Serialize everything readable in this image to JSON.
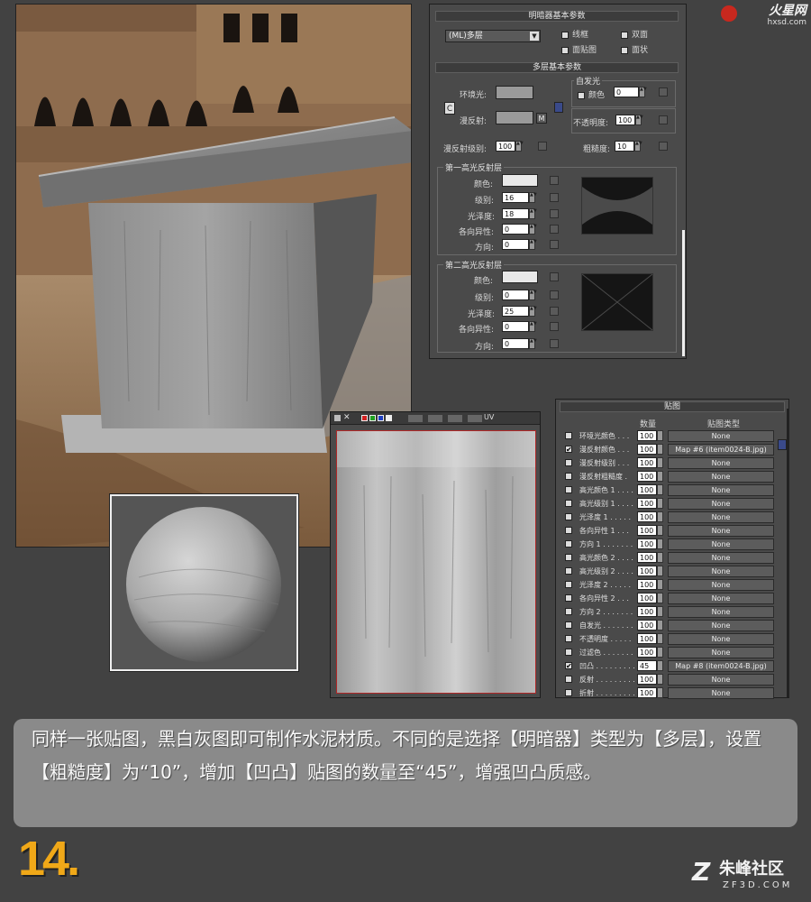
{
  "watermark_top": {
    "brand": "火星网",
    "domain": "hxsd.com"
  },
  "shader_panel": {
    "title": "明暗器基本参数",
    "shader_type": "(ML)多层",
    "checkboxes": [
      "线框",
      "双面",
      "面贴图",
      "面状"
    ],
    "multilayer_title": "多层基本参数",
    "ambient_label": "环境光:",
    "diffuse_label": "漫反射:",
    "lock_glyph": "C",
    "m_button": "M",
    "self_illum_group": "自发光",
    "color_label": "颜色",
    "self_illum_value": "0",
    "opacity_label": "不透明度:",
    "opacity_value": "100",
    "diffuse_level_label": "漫反射级别:",
    "diffuse_level_value": "100",
    "roughness_label": "粗糙度:",
    "roughness_value": "10",
    "spec1": {
      "title": "第一高光反射层",
      "color_label": "颜色:",
      "level_label": "级别:",
      "level": "16",
      "gloss_label": "光泽度:",
      "gloss": "18",
      "aniso_label": "各向异性:",
      "aniso": "0",
      "orient_label": "方向:",
      "orient": "0"
    },
    "spec2": {
      "title": "第二高光反射层",
      "color_label": "颜色:",
      "level_label": "级别:",
      "level": "0",
      "gloss_label": "光泽度:",
      "gloss": "25",
      "aniso_label": "各向异性:",
      "aniso": "0",
      "orient_label": "方向:",
      "orient": "0"
    }
  },
  "maps_panel": {
    "title": "贴图",
    "col_amount": "数量",
    "col_type": "贴图类型",
    "rows": [
      {
        "name": "环境光颜色 . . .",
        "checked": false,
        "amount": "100",
        "map": "None"
      },
      {
        "name": "漫反射颜色 . . .",
        "checked": true,
        "amount": "100",
        "map": "Map #6 (item0024-B.jpg)"
      },
      {
        "name": "漫反射级别 . . .",
        "checked": false,
        "amount": "100",
        "map": "None"
      },
      {
        "name": "漫反射粗糙度 .",
        "checked": false,
        "amount": "100",
        "map": "None"
      },
      {
        "name": "高光颜色 1 . . . .",
        "checked": false,
        "amount": "100",
        "map": "None"
      },
      {
        "name": "高光级别 1 . . . .",
        "checked": false,
        "amount": "100",
        "map": "None"
      },
      {
        "name": "光泽度 1 . . . . .",
        "checked": false,
        "amount": "100",
        "map": "None"
      },
      {
        "name": "各向异性 1 . . .",
        "checked": false,
        "amount": "100",
        "map": "None"
      },
      {
        "name": "方向 1 . . . . . . .",
        "checked": false,
        "amount": "100",
        "map": "None"
      },
      {
        "name": "高光颜色 2 . . . .",
        "checked": false,
        "amount": "100",
        "map": "None"
      },
      {
        "name": "高光级别 2 . . . .",
        "checked": false,
        "amount": "100",
        "map": "None"
      },
      {
        "name": "光泽度 2 . . . . .",
        "checked": false,
        "amount": "100",
        "map": "None"
      },
      {
        "name": "各向异性 2 . . .",
        "checked": false,
        "amount": "100",
        "map": "None"
      },
      {
        "name": "方向 2 . . . . . . .",
        "checked": false,
        "amount": "100",
        "map": "None"
      },
      {
        "name": "自发光 . . . . . . .",
        "checked": false,
        "amount": "100",
        "map": "None"
      },
      {
        "name": "不透明度 . . . . .",
        "checked": false,
        "amount": "100",
        "map": "None"
      },
      {
        "name": "过滤色 . . . . . . .",
        "checked": false,
        "amount": "100",
        "map": "None"
      },
      {
        "name": "凹凸 . . . . . . . . .",
        "checked": true,
        "amount": "45",
        "map": "Map #8 (item0024-B.jpg)"
      },
      {
        "name": "反射 . . . . . . . . .",
        "checked": false,
        "amount": "100",
        "map": "None"
      },
      {
        "name": "折射 . . . . . . . . .",
        "checked": false,
        "amount": "100",
        "map": "None"
      }
    ]
  },
  "texture_window": {
    "uv_label": "UV"
  },
  "caption": {
    "text": "同样一张贴图，黑白灰图即可制作水泥材质。不同的是选择【明暗器】类型为【多层】，设置【粗糙度】为“10”，增加【凹凸】贴图的数量至“45”，增强凹凸质感。"
  },
  "step_number": "14.",
  "watermark_bottom": {
    "brand": "朱峰社区",
    "domain": "ZF3D.COM"
  },
  "colors": {
    "step_number": "#f0a818",
    "caption_bg": "#8a8a8a",
    "panel_bg": "#4a4a4a"
  }
}
